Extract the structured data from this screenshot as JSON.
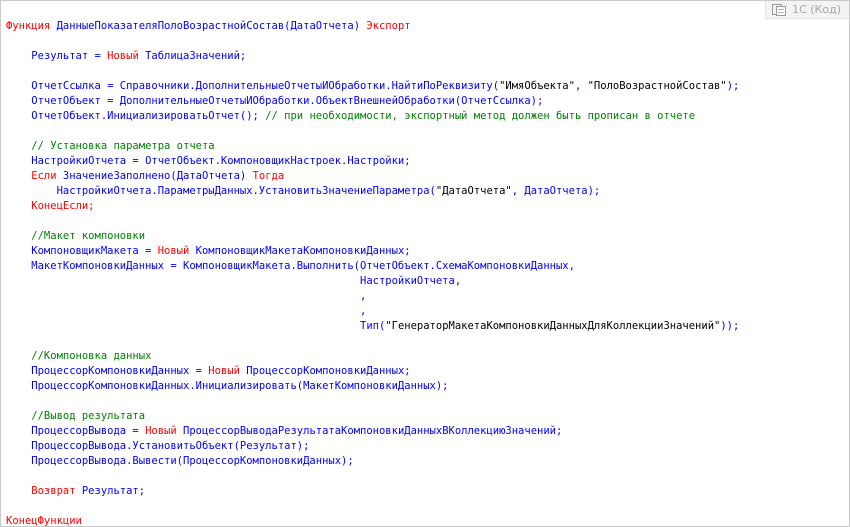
{
  "header": {
    "language_label": "1С (Код)",
    "copy_icon": "copy-icon"
  },
  "colors": {
    "keyword": "#ff0000",
    "identifier": "#0000ff",
    "string": "#000000",
    "comment": "#008000"
  },
  "code": {
    "lines": [
      [
        {
          "k": "kw",
          "t": "Функция "
        },
        {
          "k": "txt",
          "t": "ДанныеПоказателяПолоВозрастнойСостав(ДатаОтчета) "
        },
        {
          "k": "kw",
          "t": "Экспорт"
        }
      ],
      [],
      [
        {
          "k": "txt",
          "t": "    Результат = "
        },
        {
          "k": "kw",
          "t": "Новый "
        },
        {
          "k": "txt",
          "t": "ТаблицаЗначений;"
        }
      ],
      [],
      [
        {
          "k": "txt",
          "t": "    ОтчетСсылка = Справочники.ДополнительныеОтчетыИОбработки.НайтиПоРеквизиту("
        },
        {
          "k": "str",
          "t": "\"ИмяОбъекта\""
        },
        {
          "k": "txt",
          "t": ", "
        },
        {
          "k": "str",
          "t": "\"ПолоВозрастнойСостав\""
        },
        {
          "k": "txt",
          "t": ");"
        }
      ],
      [
        {
          "k": "txt",
          "t": "    ОтчетОбъект = ДополнительныеОтчетыИОбработки.ОбъектВнешнейОбработки(ОтчетСсылка);"
        }
      ],
      [
        {
          "k": "txt",
          "t": "    ОтчетОбъект.ИнициализироватьОтчет(); "
        },
        {
          "k": "cmt",
          "t": "// при необходимости, экспортный метод должен быть прописан в отчете"
        }
      ],
      [],
      [
        {
          "k": "cmt",
          "t": "    // Установка параметра отчета"
        }
      ],
      [
        {
          "k": "txt",
          "t": "    НастройкиОтчета = ОтчетОбъект.КомпоновщикНастроек.Настройки;"
        }
      ],
      [
        {
          "k": "kw",
          "t": "    Если "
        },
        {
          "k": "txt",
          "t": "ЗначениеЗаполнено(ДатаОтчета) "
        },
        {
          "k": "kw",
          "t": "Тогда"
        }
      ],
      [
        {
          "k": "txt",
          "t": "        НастройкиОтчета.ПараметрыДанных.УстановитьЗначениеПараметра("
        },
        {
          "k": "str",
          "t": "\"ДатаОтчета\""
        },
        {
          "k": "txt",
          "t": ", ДатаОтчета);"
        }
      ],
      [
        {
          "k": "kw",
          "t": "    КонецЕсли;"
        }
      ],
      [],
      [
        {
          "k": "cmt",
          "t": "    //Макет компоновки"
        }
      ],
      [
        {
          "k": "txt",
          "t": "    КомпоновщикМакета = "
        },
        {
          "k": "kw",
          "t": "Новый "
        },
        {
          "k": "txt",
          "t": "КомпоновщикМакетаКомпоновкиДанных;"
        }
      ],
      [
        {
          "k": "txt",
          "t": "    МакетКомпоновкиДанных = КомпоновщикМакета.Выполнить(ОтчетОбъект.СхемаКомпоновкиДанных,"
        }
      ],
      [
        {
          "k": "txt",
          "t": "                                                        НастройкиОтчета,"
        }
      ],
      [
        {
          "k": "txt",
          "t": "                                                        ,"
        }
      ],
      [
        {
          "k": "txt",
          "t": "                                                        ,"
        }
      ],
      [
        {
          "k": "txt",
          "t": "                                                        Тип("
        },
        {
          "k": "str",
          "t": "\"ГенераторМакетаКомпоновкиДанныхДляКоллекцииЗначений\""
        },
        {
          "k": "txt",
          "t": "));"
        }
      ],
      [],
      [
        {
          "k": "cmt",
          "t": "    //Компоновка данных"
        }
      ],
      [
        {
          "k": "txt",
          "t": "    ПроцессорКомпоновкиДанных = "
        },
        {
          "k": "kw",
          "t": "Новый "
        },
        {
          "k": "txt",
          "t": "ПроцессорКомпоновкиДанных;"
        }
      ],
      [
        {
          "k": "txt",
          "t": "    ПроцессорКомпоновкиДанных.Инициализировать(МакетКомпоновкиДанных);"
        }
      ],
      [],
      [
        {
          "k": "cmt",
          "t": "    //Вывод результата"
        }
      ],
      [
        {
          "k": "txt",
          "t": "    ПроцессорВывода = "
        },
        {
          "k": "kw",
          "t": "Новый "
        },
        {
          "k": "txt",
          "t": "ПроцессорВыводаРезультатаКомпоновкиДанныхВКоллекциюЗначений;"
        }
      ],
      [
        {
          "k": "txt",
          "t": "    ПроцессорВывода.УстановитьОбъект(Результат);"
        }
      ],
      [
        {
          "k": "txt",
          "t": "    ПроцессорВывода.Вывести(ПроцессорКомпоновкиДанных);"
        }
      ],
      [],
      [
        {
          "k": "kw",
          "t": "    Возврат "
        },
        {
          "k": "txt",
          "t": "Результат;"
        }
      ],
      [],
      [
        {
          "k": "kw",
          "t": "КонецФункции"
        }
      ]
    ]
  }
}
